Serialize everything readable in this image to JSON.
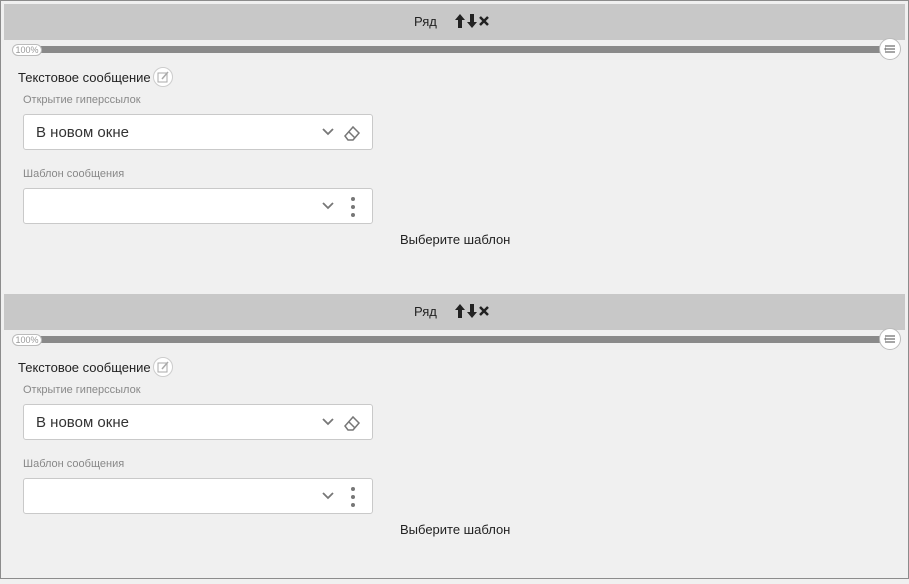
{
  "rows": [
    {
      "header": {
        "title": "Ряд"
      },
      "progress": {
        "label": "100%",
        "percent": 100
      },
      "section_title": "Текстовое сообщение",
      "hyperlinks": {
        "label": "Открытие гиперссылок",
        "value": "В новом окне"
      },
      "template": {
        "label": "Шаблон сообщения",
        "value": ""
      },
      "choose_template": "Выберите шаблон"
    },
    {
      "header": {
        "title": "Ряд"
      },
      "progress": {
        "label": "100%",
        "percent": 100
      },
      "section_title": "Текстовое сообщение",
      "hyperlinks": {
        "label": "Открытие гиперссылок",
        "value": "В новом окне"
      },
      "template": {
        "label": "Шаблон сообщения",
        "value": ""
      },
      "choose_template": "Выберите шаблон"
    }
  ],
  "icons": [
    "arrow-up-icon",
    "arrow-down-icon",
    "close-icon",
    "list-icon",
    "edit-icon",
    "chevron-down-icon",
    "eraser-icon",
    "more-vertical-icon"
  ],
  "colors": {
    "header_bg": "#c8c8c8",
    "bar": "#8a8a8a",
    "page_bg": "#f0f0f0"
  }
}
